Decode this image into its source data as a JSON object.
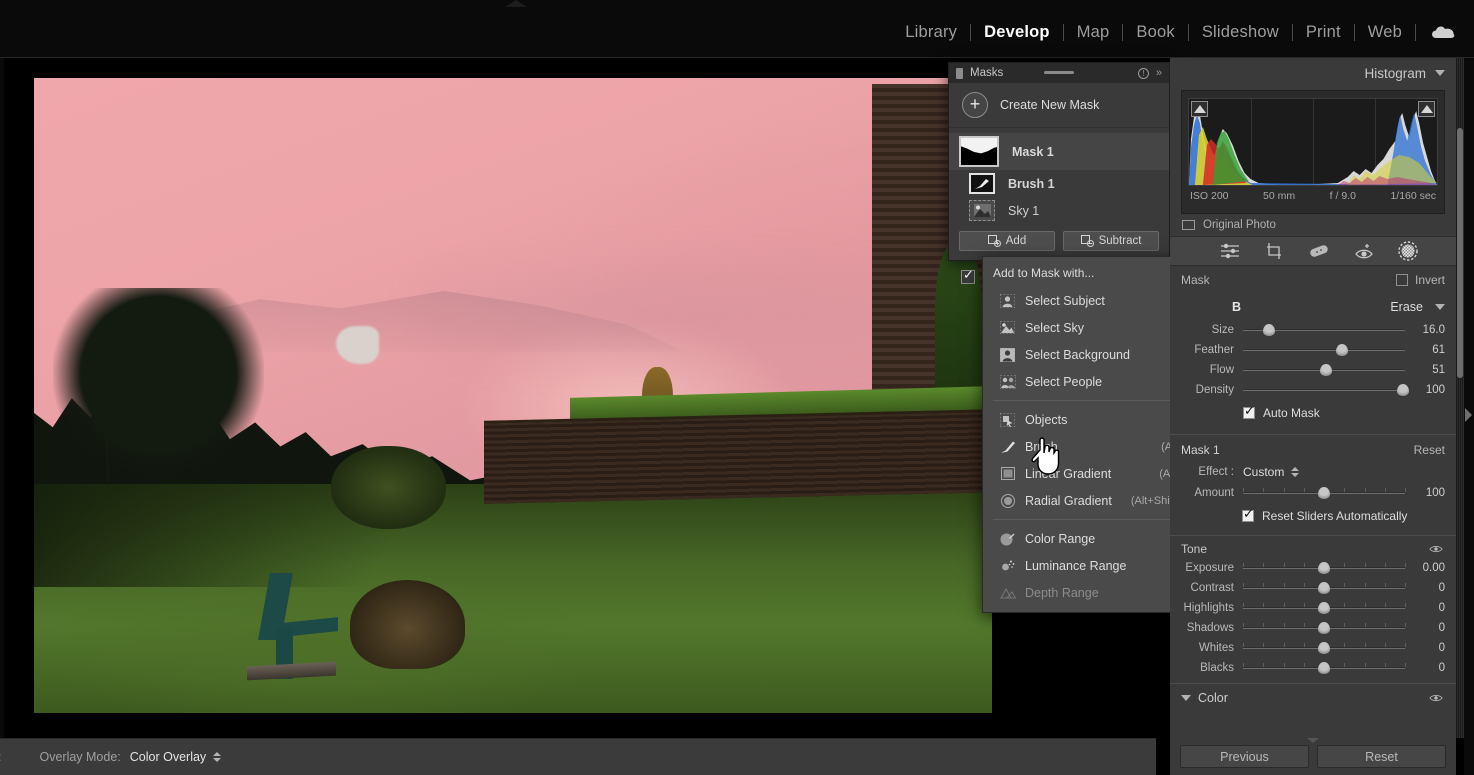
{
  "app": {
    "modules": [
      {
        "label": "Library",
        "active": false
      },
      {
        "label": "Develop",
        "active": true
      },
      {
        "label": "Map",
        "active": false
      },
      {
        "label": "Book",
        "active": false
      },
      {
        "label": "Slideshow",
        "active": false
      },
      {
        "label": "Print",
        "active": false
      },
      {
        "label": "Web",
        "active": false
      }
    ],
    "cloud_icon": "cloud-icon"
  },
  "masks_panel": {
    "title": "Masks",
    "info_icon": "info-icon",
    "collapse_icon": "chevron-double-right-icon",
    "create_new_mask": "Create New Mask",
    "plus_icon": "plus-circle-icon",
    "items": [
      {
        "name": "Mask 1",
        "icon": "mask-thumbnail-icon",
        "selected": true
      },
      {
        "name": "Brush 1",
        "icon": "brush-icon",
        "selected": false
      },
      {
        "name": "Sky 1",
        "icon": "sky-icon",
        "selected": false
      }
    ],
    "add_label": "Add",
    "subtract_label": "Subtract",
    "add_icon": "add-mask-icon",
    "subtract_icon": "subtract-mask-icon"
  },
  "context_menu": {
    "header": "Add to Mask with...",
    "groups": [
      [
        {
          "label": "Select Subject",
          "shortcut": "",
          "icon": "person-icon",
          "disabled": false
        },
        {
          "label": "Select Sky",
          "shortcut": "",
          "icon": "sky-icon",
          "disabled": false
        },
        {
          "label": "Select Background",
          "shortcut": "",
          "icon": "background-icon",
          "disabled": false
        },
        {
          "label": "Select People",
          "shortcut": "",
          "icon": "people-icon",
          "disabled": false
        }
      ],
      [
        {
          "label": "Objects",
          "shortcut": "",
          "icon": "objects-icon",
          "disabled": false
        },
        {
          "label": "Brush",
          "shortcut": "(Alt+K)",
          "icon": "brush-icon",
          "disabled": false
        },
        {
          "label": "Linear Gradient",
          "shortcut": "(Alt+M)",
          "icon": "linear-gradient-icon",
          "disabled": false
        },
        {
          "label": "Radial Gradient",
          "shortcut": "(Alt+Shift+M)",
          "icon": "radial-gradient-icon",
          "disabled": false
        }
      ],
      [
        {
          "label": "Color Range",
          "shortcut": "",
          "icon": "color-range-icon",
          "disabled": false
        },
        {
          "label": "Luminance Range",
          "shortcut": "",
          "icon": "luminance-range-icon",
          "disabled": false
        },
        {
          "label": "Depth Range",
          "shortcut": "",
          "icon": "depth-range-icon",
          "disabled": true
        }
      ]
    ]
  },
  "histogram": {
    "title": "Histogram",
    "collapse_icon": "triangle-down-icon",
    "clip_left_icon": "shadow-clipping-icon",
    "clip_right_icon": "highlight-clipping-icon",
    "meta": {
      "iso": "ISO 200",
      "focal": "50 mm",
      "aperture": "f / 9.0",
      "shutter": "1/160 sec"
    },
    "original_photo": "Original Photo"
  },
  "tool_strip": {
    "icons": [
      {
        "name": "basic-sliders-icon"
      },
      {
        "name": "crop-icon"
      },
      {
        "name": "healing-brush-icon"
      },
      {
        "name": "red-eye-icon"
      },
      {
        "name": "masking-icon"
      }
    ]
  },
  "brush_panel": {
    "mask_label": "Mask",
    "invert_label": "Invert",
    "invert_checked": false,
    "brush_letter": "B",
    "erase_label": "Erase",
    "erase_dropdown_icon": "triangle-down-icon",
    "sliders": [
      {
        "label": "Size",
        "value": "16.0",
        "pct": 16
      },
      {
        "label": "Feather",
        "value": "61",
        "pct": 61
      },
      {
        "label": "Flow",
        "value": "51",
        "pct": 51
      },
      {
        "label": "Density",
        "value": "100",
        "pct": 100
      }
    ],
    "auto_mask_label": "Auto Mask",
    "auto_mask_checked": true
  },
  "effects_panel": {
    "mask_title": "Mask 1",
    "reset_label": "Reset",
    "effect_label": "Effect :",
    "effect_value": "Custom",
    "amount_label": "Amount",
    "amount_value": "100",
    "amount_pct": 50,
    "reset_sliders_label": "Reset Sliders Automatically",
    "reset_sliders_checked": true
  },
  "tone_panel": {
    "title": "Tone",
    "eye_icon": "eye-icon",
    "sliders": [
      {
        "label": "Exposure",
        "value": "0.00",
        "pct": 50
      },
      {
        "label": "Contrast",
        "value": "0",
        "pct": 50
      },
      {
        "label": "Highlights",
        "value": "0",
        "pct": 50
      },
      {
        "label": "Shadows",
        "value": "0",
        "pct": 50
      },
      {
        "label": "Whites",
        "value": "0",
        "pct": 50
      },
      {
        "label": "Blacks",
        "value": "0",
        "pct": 50
      }
    ]
  },
  "color_panel": {
    "title": "Color",
    "expand_icon": "triangle-down-icon",
    "eye_icon": "eye-icon"
  },
  "bottom_bar": {
    "toolbar_toggle": ":",
    "overlay_mode_label": "Overlay Mode:",
    "overlay_mode_value": "Color Overlay",
    "previous_label": "Previous",
    "reset_label": "Reset"
  },
  "colors": {
    "panel_bg": "#3a3a3a",
    "canvas_bg": "#000000",
    "accent_text": "#ffffff",
    "overlay_pink": "#e8a0a6"
  }
}
